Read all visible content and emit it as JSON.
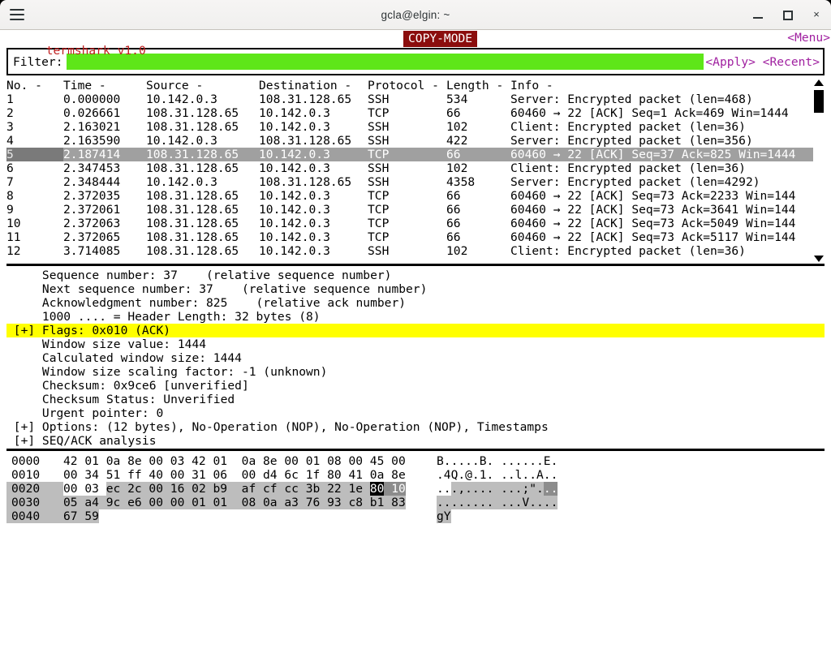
{
  "titlebar": {
    "title": "gcla@elgin: ~",
    "menu_icon": "hamburger-icon",
    "minimize_label": "",
    "maximize_label": "",
    "close_label": "×"
  },
  "appbar": {
    "app_name": "termshark v1.0",
    "mode_badge": "COPY-MODE",
    "menu_link": "<Menu>"
  },
  "filter": {
    "label": "Filter:",
    "value": "",
    "placeholder": "",
    "apply_label": "<Apply>",
    "recent_label": "<Recent>"
  },
  "packet_list": {
    "columns": [
      "No. -",
      "Time -",
      "Source -",
      "Destination -",
      "Protocol -",
      "Length -",
      "Info -"
    ],
    "selected_row_index": 4,
    "rows": [
      {
        "no": "1",
        "time": "0.000000",
        "src": "10.142.0.3",
        "dst": "108.31.128.65",
        "proto": "SSH",
        "len": "534",
        "info": "Server: Encrypted packet (len=468)"
      },
      {
        "no": "2",
        "time": "0.026661",
        "src": "108.31.128.65",
        "dst": "10.142.0.3",
        "proto": "TCP",
        "len": "66",
        "info": "60460 → 22 [ACK] Seq=1 Ack=469 Win=1444"
      },
      {
        "no": "3",
        "time": "2.163021",
        "src": "108.31.128.65",
        "dst": "10.142.0.3",
        "proto": "SSH",
        "len": "102",
        "info": "Client: Encrypted packet (len=36)"
      },
      {
        "no": "4",
        "time": "2.163590",
        "src": "10.142.0.3",
        "dst": "108.31.128.65",
        "proto": "SSH",
        "len": "422",
        "info": "Server: Encrypted packet (len=356)"
      },
      {
        "no": "5",
        "time": "2.187414",
        "src": "108.31.128.65",
        "dst": "10.142.0.3",
        "proto": "TCP",
        "len": "66",
        "info": "60460 → 22 [ACK] Seq=37 Ack=825 Win=1444"
      },
      {
        "no": "6",
        "time": "2.347453",
        "src": "108.31.128.65",
        "dst": "10.142.0.3",
        "proto": "SSH",
        "len": "102",
        "info": "Client: Encrypted packet (len=36)"
      },
      {
        "no": "7",
        "time": "2.348444",
        "src": "10.142.0.3",
        "dst": "108.31.128.65",
        "proto": "SSH",
        "len": "4358",
        "info": "Server: Encrypted packet (len=4292)"
      },
      {
        "no": "8",
        "time": "2.372035",
        "src": "108.31.128.65",
        "dst": "10.142.0.3",
        "proto": "TCP",
        "len": "66",
        "info": "60460 → 22 [ACK] Seq=73 Ack=2233 Win=144"
      },
      {
        "no": "9",
        "time": "2.372061",
        "src": "108.31.128.65",
        "dst": "10.142.0.3",
        "proto": "TCP",
        "len": "66",
        "info": "60460 → 22 [ACK] Seq=73 Ack=3641 Win=144"
      },
      {
        "no": "10",
        "time": "2.372063",
        "src": "108.31.128.65",
        "dst": "10.142.0.3",
        "proto": "TCP",
        "len": "66",
        "info": "60460 → 22 [ACK] Seq=73 Ack=5049 Win=144"
      },
      {
        "no": "11",
        "time": "2.372065",
        "src": "108.31.128.65",
        "dst": "10.142.0.3",
        "proto": "TCP",
        "len": "66",
        "info": "60460 → 22 [ACK] Seq=73 Ack=5117 Win=144"
      },
      {
        "no": "12",
        "time": "3.714085",
        "src": "108.31.128.65",
        "dst": "10.142.0.3",
        "proto": "SSH",
        "len": "102",
        "info": "Client: Encrypted packet (len=36)"
      }
    ],
    "scroll_up_icon": "triangle-up-icon",
    "scroll_down_icon": "triangle-down-icon"
  },
  "detail": {
    "lines": [
      {
        "expander": "    ",
        "text": "Sequence number: 37    (relative sequence number)",
        "highlight": false
      },
      {
        "expander": "    ",
        "text": "Next sequence number: 37    (relative sequence number)",
        "highlight": false
      },
      {
        "expander": "    ",
        "text": "Acknowledgment number: 825    (relative ack number)",
        "highlight": false
      },
      {
        "expander": "    ",
        "text": "1000 .... = Header Length: 32 bytes (8)",
        "highlight": false
      },
      {
        "expander": " [+]",
        "text": "Flags: 0x010 (ACK)",
        "highlight": true
      },
      {
        "expander": "    ",
        "text": "Window size value: 1444",
        "highlight": false
      },
      {
        "expander": "    ",
        "text": "Calculated window size: 1444",
        "highlight": false
      },
      {
        "expander": "    ",
        "text": "Window size scaling factor: -1 (unknown)",
        "highlight": false
      },
      {
        "expander": "    ",
        "text": "Checksum: 0x9ce6 [unverified]",
        "highlight": false
      },
      {
        "expander": "    ",
        "text": "Checksum Status: Unverified",
        "highlight": false
      },
      {
        "expander": "    ",
        "text": "Urgent pointer: 0",
        "highlight": false
      },
      {
        "expander": " [+]",
        "text": "Options: (12 bytes), No-Operation (NOP), No-Operation (NOP), Timestamps",
        "highlight": false
      },
      {
        "expander": " [+]",
        "text": "SEQ/ACK analysis",
        "highlight": false
      }
    ]
  },
  "hexdump": {
    "rows": [
      {
        "offset": "0000",
        "offset_selected": false,
        "hex_segments": [
          {
            "text": "42 01 0a 8e 00 03 42 01  0a 8e 00 01 08 00 45 00",
            "style": "none"
          }
        ],
        "ascii_segments": [
          {
            "text": "B.....B. ......E.",
            "style": "none"
          }
        ]
      },
      {
        "offset": "0010",
        "offset_selected": false,
        "hex_segments": [
          {
            "text": "00 34 51 ff 40 00 31 06  00 d4 6c 1f 80 41 0a 8e",
            "style": "none"
          }
        ],
        "ascii_segments": [
          {
            "text": ".4Q.@.1. ..l..A..",
            "style": "none"
          }
        ]
      },
      {
        "offset": "0020",
        "offset_selected": true,
        "hex_segments": [
          {
            "text": "00 03 ",
            "style": "none"
          },
          {
            "text": "ec 2c 00 16 02 b9  af cf cc 3b 22 1e ",
            "style": "light"
          },
          {
            "text": "80",
            "style": "key"
          },
          {
            "text": " ",
            "style": "dark"
          },
          {
            "text": "10",
            "style": "dark"
          }
        ],
        "ascii_segments": [
          {
            "text": "..",
            "style": "none"
          },
          {
            "text": ".,.... ...;\".",
            "style": "light"
          },
          {
            "text": "..",
            "style": "dark"
          }
        ]
      },
      {
        "offset": "0030",
        "offset_selected": true,
        "hex_segments": [
          {
            "text": "05 a4 9c e6 00 00 01 01  08 0a a3 76 93 c8 b1 83",
            "style": "light"
          }
        ],
        "ascii_segments": [
          {
            "text": "........ ...V....",
            "style": "light"
          }
        ]
      },
      {
        "offset": "0040",
        "offset_selected": true,
        "hex_segments": [
          {
            "text": "67 59",
            "style": "light"
          }
        ],
        "ascii_segments": [
          {
            "text": "gY",
            "style": "light"
          }
        ]
      }
    ]
  },
  "colors": {
    "filter_input_bg": "#5ee619",
    "accent_magenta": "#a020a0",
    "app_name_red": "#c02020",
    "badge_bg": "#8b0d0d",
    "highlight_yellow": "#ffff00",
    "selected_row_bg": "#a0a0a0",
    "selected_no_bg": "#7a7a7a",
    "hex_light": "#bdbdbd",
    "hex_dark": "#8c8c8c",
    "hex_key": "#000000"
  }
}
